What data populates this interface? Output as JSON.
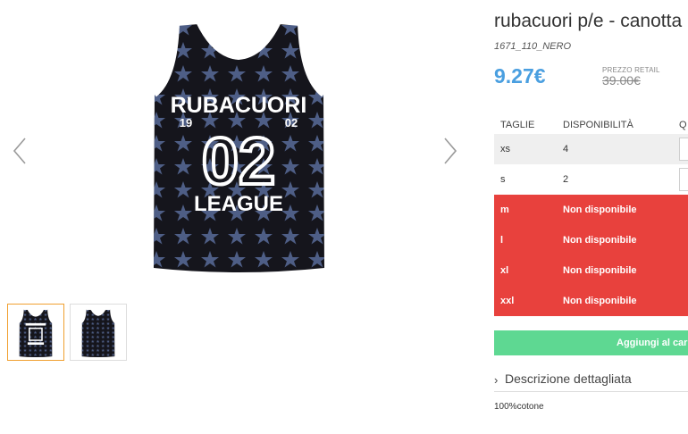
{
  "product": {
    "title": "rubacuori p/e - canotta",
    "sku": "1671_110_NERO",
    "price": "9.27€",
    "retail_label": "PREZZO RETAIL",
    "retail_price": "39.00€",
    "composition": "100%cotone"
  },
  "image_print": {
    "top": "RUBACUORI",
    "year_left": "19",
    "year_right": "02",
    "number": "02",
    "bottom": "LEAGUE"
  },
  "sizes_table": {
    "headers": [
      "TAGLIE",
      "DISPONIBILITÀ",
      "Q"
    ],
    "rows": [
      {
        "size": "xs",
        "availability": "4"
      },
      {
        "size": "s",
        "availability": "2"
      },
      {
        "size": "m",
        "availability": "Non disponibile"
      },
      {
        "size": "l",
        "availability": "Non disponibile"
      },
      {
        "size": "xl",
        "availability": "Non disponibile"
      },
      {
        "size": "xxl",
        "availability": "Non disponibile"
      }
    ]
  },
  "actions": {
    "add_to_cart": "Aggiungi al carrello"
  },
  "description": {
    "label": "Descrizione dettagliata",
    "chevron": "›"
  },
  "colors": {
    "accent_blue": "#4a9fe0",
    "unavailable_red": "#e8413d",
    "add_green": "#5ed892",
    "thumb_active": "#f0a030"
  }
}
